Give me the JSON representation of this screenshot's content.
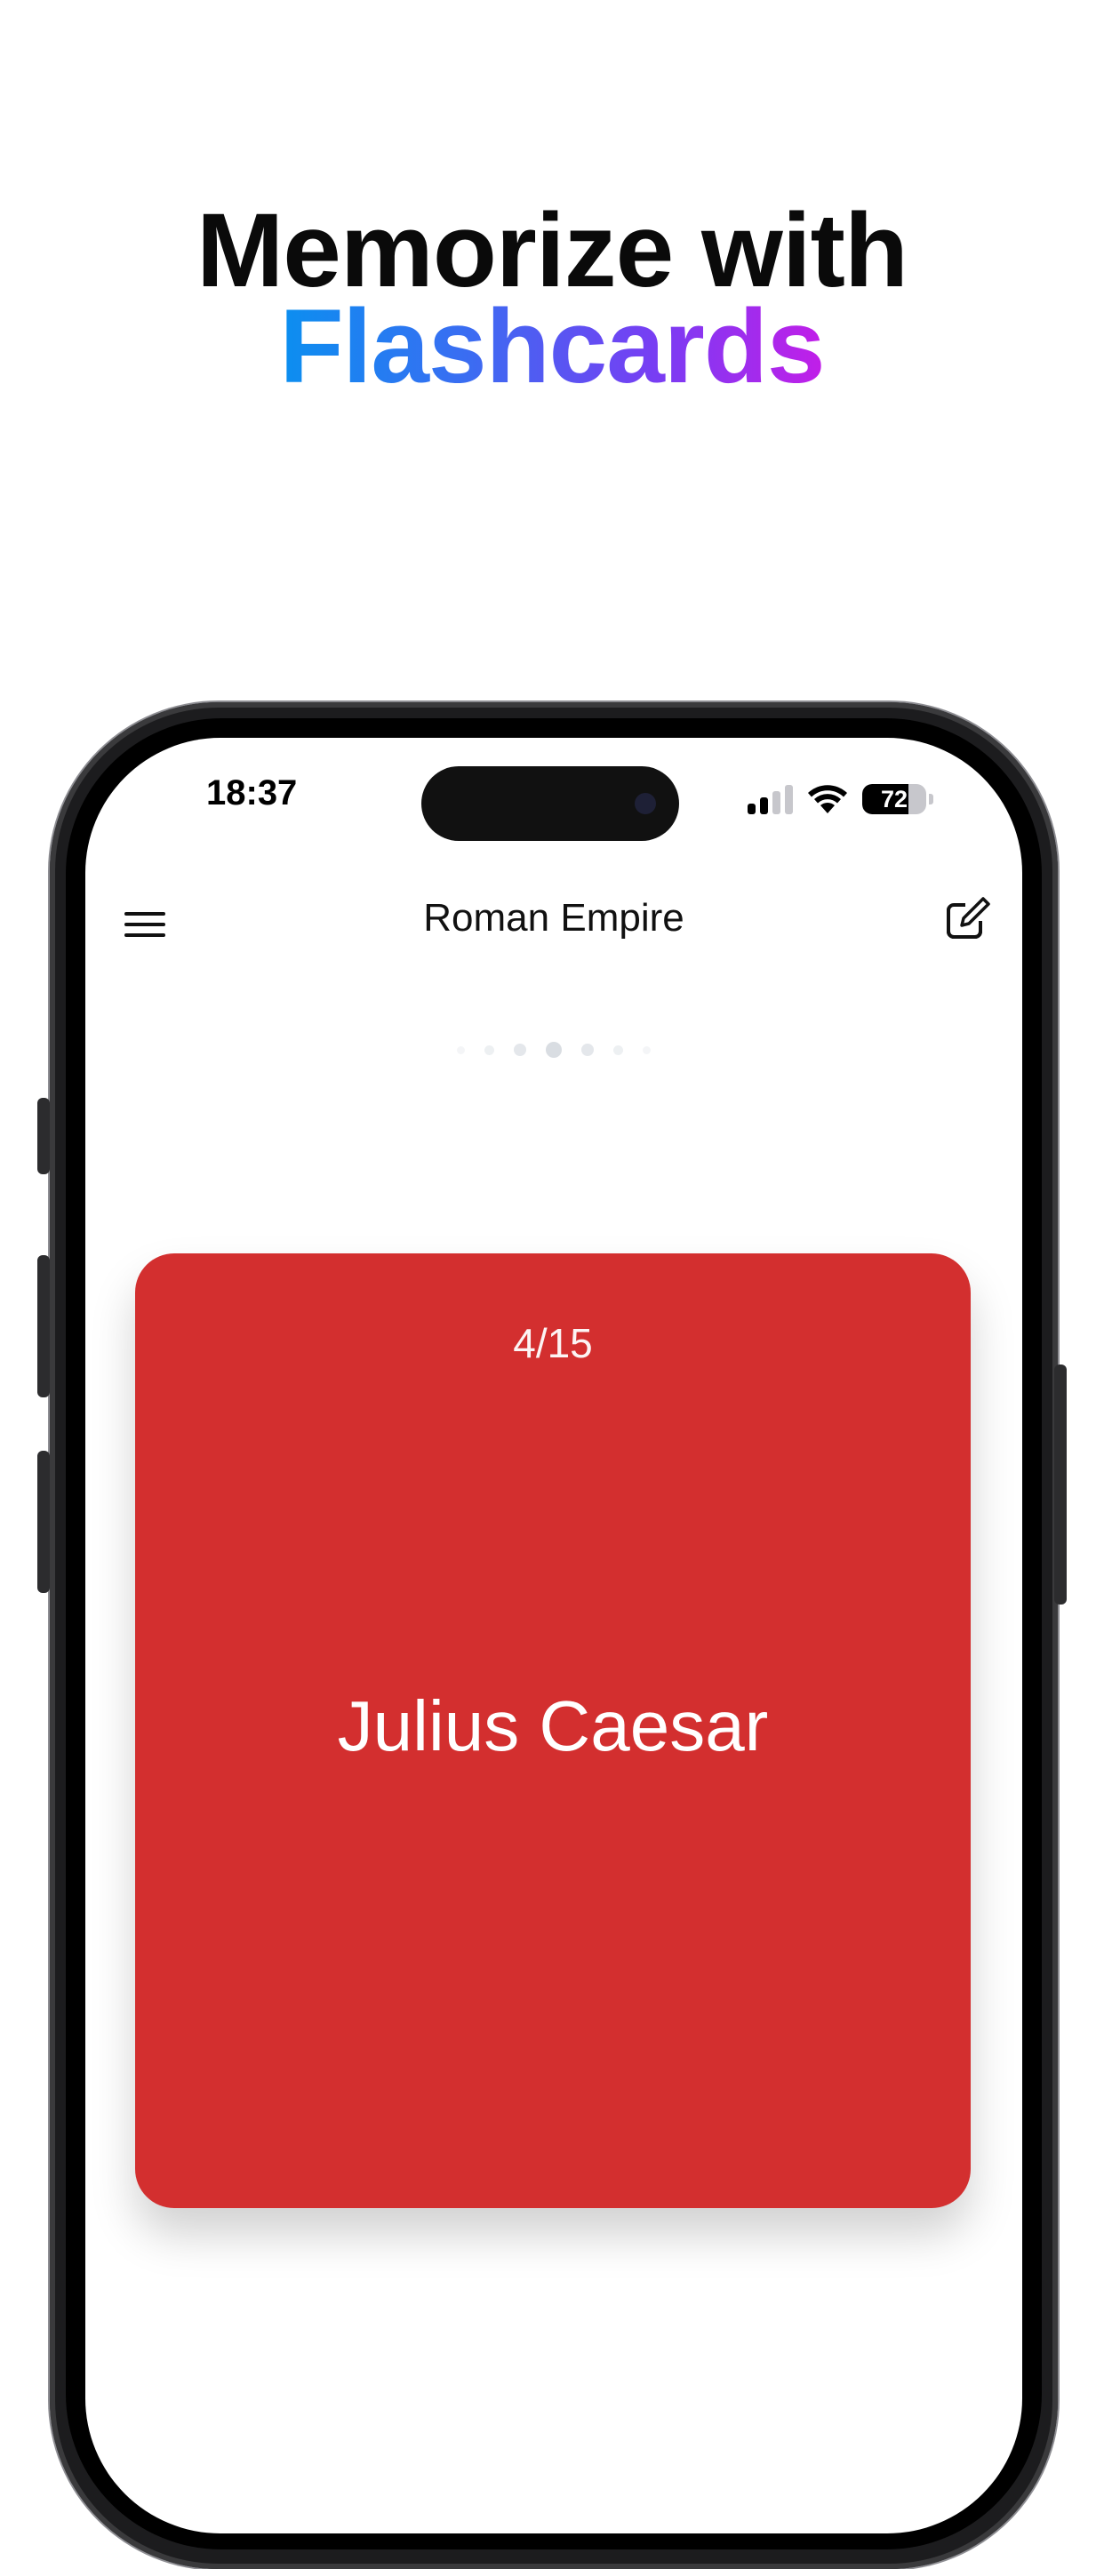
{
  "headline": {
    "line1": "Memorize with",
    "line2": "Flashcards"
  },
  "status_bar": {
    "time": "18:37",
    "battery": "72",
    "battery_level": 0.72,
    "signal_bars_active": 2,
    "signal_bars_total": 4
  },
  "nav": {
    "title": "Roman Empire",
    "menu_icon": "hamburger-menu-icon",
    "edit_icon": "edit-square-icon"
  },
  "pager": {
    "dot_count": 7,
    "active_index": 3
  },
  "card": {
    "counter": "4/15",
    "term": "Julius Caesar",
    "color": "#d32f2f"
  },
  "colors": {
    "gradient_start": "#0b8ff0",
    "gradient_end": "#c21ee8"
  }
}
